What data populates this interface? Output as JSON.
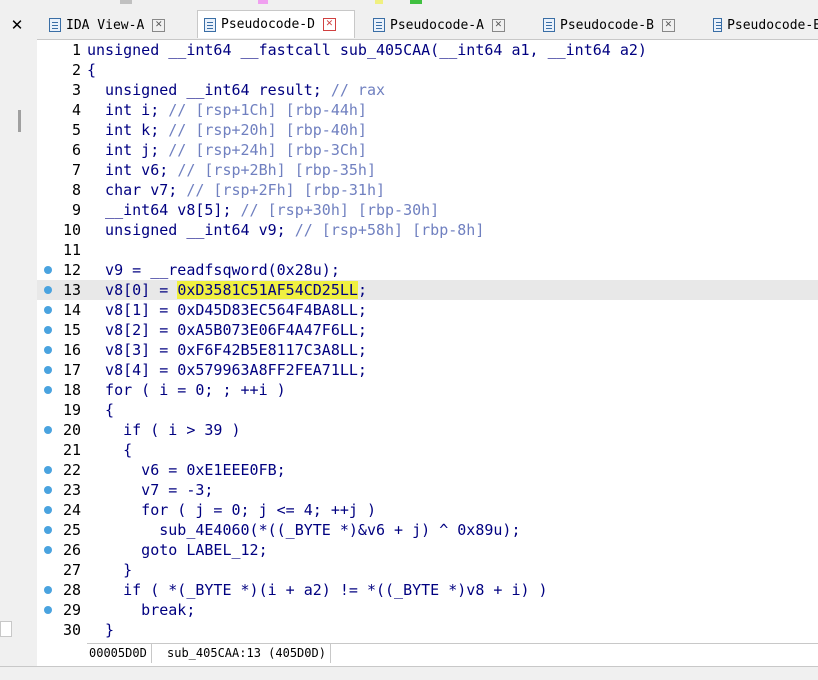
{
  "close_glyph": "✕",
  "tabs": [
    {
      "label": "IDA View-A",
      "close": "✕",
      "active": false
    },
    {
      "label": "Pseudocode-D",
      "close": "✕",
      "active": true
    },
    {
      "label": "Pseudocode-A",
      "close": "✕",
      "active": false
    },
    {
      "label": "Pseudocode-B",
      "close": "✕",
      "active": false
    },
    {
      "label": "Pseudocode-E",
      "close": "",
      "active": false
    }
  ],
  "colors": {
    "keyword_text": "#000080",
    "comment": "#7080c0",
    "highlight": "#f0f040",
    "breakpoint_dot": "#4aa3df",
    "legend": [
      "#c0c0c0",
      "#f0a0f0",
      "#f0f080",
      "#40c040"
    ]
  },
  "code_lines": [
    {
      "n": "1",
      "dot": false,
      "text": "unsigned __int64 __fastcall sub_405CAA(__int64 a1, __int64 a2)",
      "comment": ""
    },
    {
      "n": "2",
      "dot": false,
      "text": "{",
      "comment": ""
    },
    {
      "n": "3",
      "dot": false,
      "text": "  unsigned __int64 result; ",
      "comment": "// rax"
    },
    {
      "n": "4",
      "dot": false,
      "text": "  int i; ",
      "comment": "// [rsp+1Ch] [rbp-44h]"
    },
    {
      "n": "5",
      "dot": false,
      "text": "  int k; ",
      "comment": "// [rsp+20h] [rbp-40h]"
    },
    {
      "n": "6",
      "dot": false,
      "text": "  int j; ",
      "comment": "// [rsp+24h] [rbp-3Ch]"
    },
    {
      "n": "7",
      "dot": false,
      "text": "  int v6; ",
      "comment": "// [rsp+2Bh] [rbp-35h]"
    },
    {
      "n": "8",
      "dot": false,
      "text": "  char v7; ",
      "comment": "// [rsp+2Fh] [rbp-31h]"
    },
    {
      "n": "9",
      "dot": false,
      "text": "  __int64 v8[5]; ",
      "comment": "// [rsp+30h] [rbp-30h]"
    },
    {
      "n": "10",
      "dot": false,
      "text": "  unsigned __int64 v9; ",
      "comment": "// [rsp+58h] [rbp-8h]"
    },
    {
      "n": "11",
      "dot": false,
      "text": "",
      "comment": ""
    },
    {
      "n": "12",
      "dot": true,
      "text": "  v9 = __readfsqword(0x28u);",
      "comment": ""
    },
    {
      "n": "13",
      "dot": true,
      "pre": "  v8[0] = ",
      "hl": "0xD3581C51AF54CD25LL",
      "post": ";",
      "current": true
    },
    {
      "n": "14",
      "dot": true,
      "text": "  v8[1] = 0xD45D83EC564F4BA8LL;",
      "comment": ""
    },
    {
      "n": "15",
      "dot": true,
      "text": "  v8[2] = 0xA5B073E06F4A47F6LL;",
      "comment": ""
    },
    {
      "n": "16",
      "dot": true,
      "text": "  v8[3] = 0xF6F42B5E8117C3A8LL;",
      "comment": ""
    },
    {
      "n": "17",
      "dot": true,
      "text": "  v8[4] = 0x579963A8FF2FEA71LL;",
      "comment": ""
    },
    {
      "n": "18",
      "dot": true,
      "text": "  for ( i = 0; ; ++i )",
      "comment": ""
    },
    {
      "n": "19",
      "dot": false,
      "text": "  {",
      "comment": ""
    },
    {
      "n": "20",
      "dot": true,
      "text": "    if ( i > 39 )",
      "comment": ""
    },
    {
      "n": "21",
      "dot": false,
      "text": "    {",
      "comment": ""
    },
    {
      "n": "22",
      "dot": true,
      "text": "      v6 = 0xE1EEE0FB;",
      "comment": ""
    },
    {
      "n": "23",
      "dot": true,
      "text": "      v7 = -3;",
      "comment": ""
    },
    {
      "n": "24",
      "dot": true,
      "text": "      for ( j = 0; j <= 4; ++j )",
      "comment": ""
    },
    {
      "n": "25",
      "dot": true,
      "text": "        sub_4E4060(*((_BYTE *)&v6 + j) ^ 0x89u);",
      "comment": ""
    },
    {
      "n": "26",
      "dot": true,
      "text": "      goto LABEL_12;",
      "comment": ""
    },
    {
      "n": "27",
      "dot": false,
      "text": "    }",
      "comment": ""
    },
    {
      "n": "28",
      "dot": true,
      "text": "    if ( *(_BYTE *)(i + a2) != *((_BYTE *)v8 + i) )",
      "comment": ""
    },
    {
      "n": "29",
      "dot": true,
      "text": "      break;",
      "comment": ""
    },
    {
      "n": "30",
      "dot": false,
      "text": "  }",
      "comment": ""
    }
  ],
  "status": {
    "address": "00005D0D",
    "location": "sub_405CAA:13 (405D0D)"
  }
}
